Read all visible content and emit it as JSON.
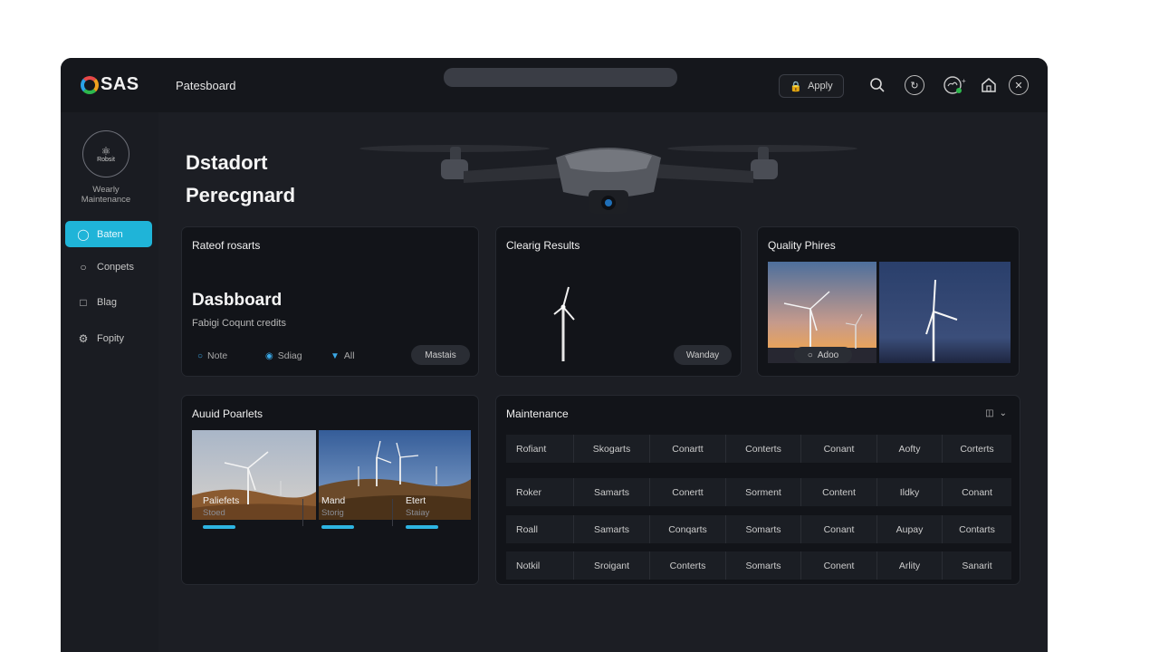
{
  "header": {
    "logo_text": "SAS",
    "nav_title": "Patesboard",
    "apply_label": "Apply",
    "icons": [
      "search-icon",
      "refresh-icon",
      "cloud-icon",
      "home-icon",
      "bluetooth-icon"
    ]
  },
  "sidebar": {
    "avatar_label": "Robsit",
    "caption_line1": "Wearly",
    "caption_line2": "Maintenance",
    "items": [
      {
        "label": "Baten",
        "icon": "home-icon",
        "active": true
      },
      {
        "label": "Conpets",
        "icon": "chat-icon",
        "active": false
      },
      {
        "label": "Blag",
        "icon": "document-icon",
        "active": false
      },
      {
        "label": "Fopity",
        "icon": "gear-icon",
        "active": false
      }
    ]
  },
  "hero": {
    "line1": "Dstadort",
    "line2": "Perecgnard"
  },
  "card_reports": {
    "title": "Rateof rosarts",
    "big_title": "Dasbboard",
    "subtitle": "Fabigi Coqunt credits",
    "options": [
      "Note",
      "Sdiag",
      "All"
    ],
    "pill": "Mastais"
  },
  "card_cleaning": {
    "title": "Clearig Results",
    "pill": "Wanday"
  },
  "card_quality": {
    "title": "Quality Phires",
    "overlay": "Adoo"
  },
  "card_projects": {
    "title": "Auuid Poarlets",
    "items": [
      {
        "name": "Paliefets",
        "sub": "Stoed",
        "progress": 0.6
      },
      {
        "name": "Mand",
        "sub": "Storig",
        "progress": 0.6
      },
      {
        "name": "Etert",
        "sub": "Staiay",
        "progress": 0.6
      }
    ]
  },
  "card_maintenance": {
    "title": "Maintenance",
    "rows": [
      [
        "Rofiant",
        "Skogarts",
        "Conartt",
        "Conterts",
        "Conant",
        "Aofty",
        "Corterts"
      ],
      [
        "Roker",
        "Samarts",
        "Conertt",
        "Sorment",
        "Content",
        "Ildky",
        "Conant"
      ],
      [
        "Roall",
        "Samarts",
        "Conqarts",
        "Somarts",
        "Conant",
        "Aupay",
        "Contarts"
      ],
      [
        "Notkil",
        "Sroigant",
        "Conterts",
        "Somarts",
        "Conent",
        "Arlity",
        "Sanarit"
      ]
    ]
  },
  "colors": {
    "accent": "#1fb4d8",
    "app_bg": "#1c1e24",
    "card_bg": "#121419"
  }
}
